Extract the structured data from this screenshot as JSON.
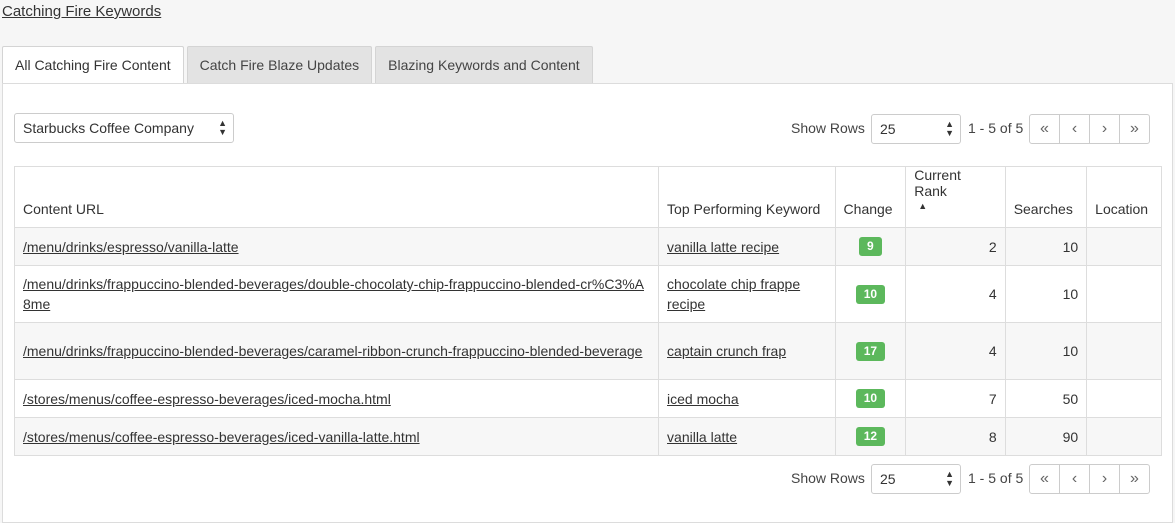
{
  "page": {
    "title": "Catching Fire Keywords"
  },
  "tabs": [
    {
      "label": "All Catching Fire Content",
      "active": true
    },
    {
      "label": "Catch Fire Blaze Updates",
      "active": false
    },
    {
      "label": "Blazing Keywords and Content",
      "active": false
    }
  ],
  "filter": {
    "company": "Starbucks Coffee Company"
  },
  "pagination": {
    "show_rows_label": "Show Rows",
    "rows_value": "25",
    "range": "1 - 5 of 5",
    "first": "«",
    "prev": "‹",
    "next": "›",
    "last": "»"
  },
  "table": {
    "headers": {
      "url": "Content URL",
      "keyword": "Top Performing Keyword",
      "change": "Change",
      "rank": "Current Rank",
      "searches": "Searches",
      "location": "Location"
    },
    "sort_icon": "sort-ascending-icon",
    "badge_color": "#5cb85c",
    "rows": [
      {
        "url": "/menu/drinks/espresso/vanilla-latte",
        "keyword": "vanilla latte recipe",
        "change": "9",
        "rank": "2",
        "searches": "10",
        "location": ""
      },
      {
        "url": "/menu/drinks/frappuccino-blended-beverages/double-chocolaty-chip-frappuccino-blended-cr%C3%A8me",
        "keyword": "chocolate chip frappe recipe",
        "change": "10",
        "rank": "4",
        "searches": "10",
        "location": ""
      },
      {
        "url": "/menu/drinks/frappuccino-blended-beverages/caramel-ribbon-crunch-frappuccino-blended-beverage",
        "keyword": "captain crunch frap",
        "change": "17",
        "rank": "4",
        "searches": "10",
        "location": ""
      },
      {
        "url": "/stores/menus/coffee-espresso-beverages/iced-mocha.html",
        "keyword": "iced mocha",
        "change": "10",
        "rank": "7",
        "searches": "50",
        "location": ""
      },
      {
        "url": "/stores/menus/coffee-espresso-beverages/iced-vanilla-latte.html",
        "keyword": "vanilla latte",
        "change": "12",
        "rank": "8",
        "searches": "90",
        "location": ""
      }
    ]
  }
}
